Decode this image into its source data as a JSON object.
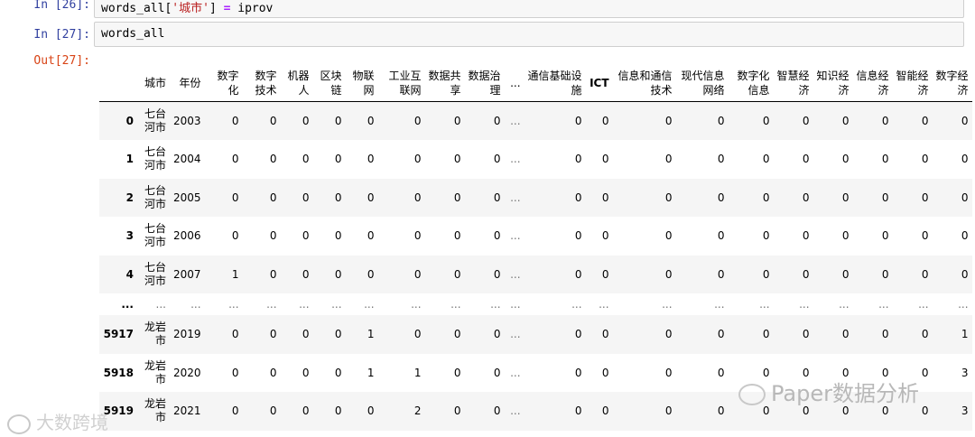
{
  "cells": {
    "prev": {
      "prompt": "In [26]:",
      "code_var": "words_all[",
      "code_str": "'城市'",
      "code_close": "]",
      "code_op": "=",
      "code_val": "iprov"
    },
    "input": {
      "prompt": "In [27]:",
      "code": "words_all"
    },
    "output": {
      "prompt": "Out[27]:"
    }
  },
  "table": {
    "columns": [
      "城市",
      "年份",
      "数字化",
      "数字技术",
      "机器人",
      "区块链",
      "物联网",
      "工业互联网",
      "数据共享",
      "数据治理",
      "...",
      "通信基础设施",
      "ICT",
      "信息和通信技术",
      "现代信息网络",
      "数字化信息",
      "智慧经济",
      "知识经济",
      "信息经济",
      "智能经济",
      "数字经济"
    ],
    "rows": [
      {
        "idx": "0",
        "cells": [
          "七台河市",
          "2003",
          "0",
          "0",
          "0",
          "0",
          "0",
          "0",
          "0",
          "0",
          "...",
          "0",
          "0",
          "0",
          "0",
          "0",
          "0",
          "0",
          "0",
          "0",
          "0"
        ]
      },
      {
        "idx": "1",
        "cells": [
          "七台河市",
          "2004",
          "0",
          "0",
          "0",
          "0",
          "0",
          "0",
          "0",
          "0",
          "...",
          "0",
          "0",
          "0",
          "0",
          "0",
          "0",
          "0",
          "0",
          "0",
          "0"
        ]
      },
      {
        "idx": "2",
        "cells": [
          "七台河市",
          "2005",
          "0",
          "0",
          "0",
          "0",
          "0",
          "0",
          "0",
          "0",
          "...",
          "0",
          "0",
          "0",
          "0",
          "0",
          "0",
          "0",
          "0",
          "0",
          "0"
        ]
      },
      {
        "idx": "3",
        "cells": [
          "七台河市",
          "2006",
          "0",
          "0",
          "0",
          "0",
          "0",
          "0",
          "0",
          "0",
          "...",
          "0",
          "0",
          "0",
          "0",
          "0",
          "0",
          "0",
          "0",
          "0",
          "0"
        ]
      },
      {
        "idx": "4",
        "cells": [
          "七台河市",
          "2007",
          "1",
          "0",
          "0",
          "0",
          "0",
          "0",
          "0",
          "0",
          "...",
          "0",
          "0",
          "0",
          "0",
          "0",
          "0",
          "0",
          "0",
          "0",
          "0"
        ]
      },
      {
        "idx": "...",
        "cells": [
          "...",
          "...",
          "...",
          "...",
          "...",
          "...",
          "...",
          "...",
          "...",
          "...",
          "...",
          "...",
          "...",
          "...",
          "...",
          "...",
          "...",
          "...",
          "...",
          "...",
          "..."
        ]
      },
      {
        "idx": "5917",
        "cells": [
          "龙岩市",
          "2019",
          "0",
          "0",
          "0",
          "0",
          "1",
          "0",
          "0",
          "0",
          "...",
          "0",
          "0",
          "0",
          "0",
          "0",
          "0",
          "0",
          "0",
          "0",
          "1"
        ]
      },
      {
        "idx": "5918",
        "cells": [
          "龙岩市",
          "2020",
          "0",
          "0",
          "0",
          "0",
          "1",
          "1",
          "0",
          "0",
          "...",
          "0",
          "0",
          "0",
          "0",
          "0",
          "0",
          "0",
          "0",
          "0",
          "3"
        ]
      },
      {
        "idx": "5919",
        "cells": [
          "龙岩市",
          "2021",
          "0",
          "0",
          "0",
          "0",
          "0",
          "2",
          "0",
          "0",
          "...",
          "0",
          "0",
          "0",
          "0",
          "0",
          "0",
          "0",
          "0",
          "0",
          "3"
        ]
      }
    ]
  },
  "watermarks": {
    "left": "大数跨境",
    "right": "Paper数据分析"
  }
}
